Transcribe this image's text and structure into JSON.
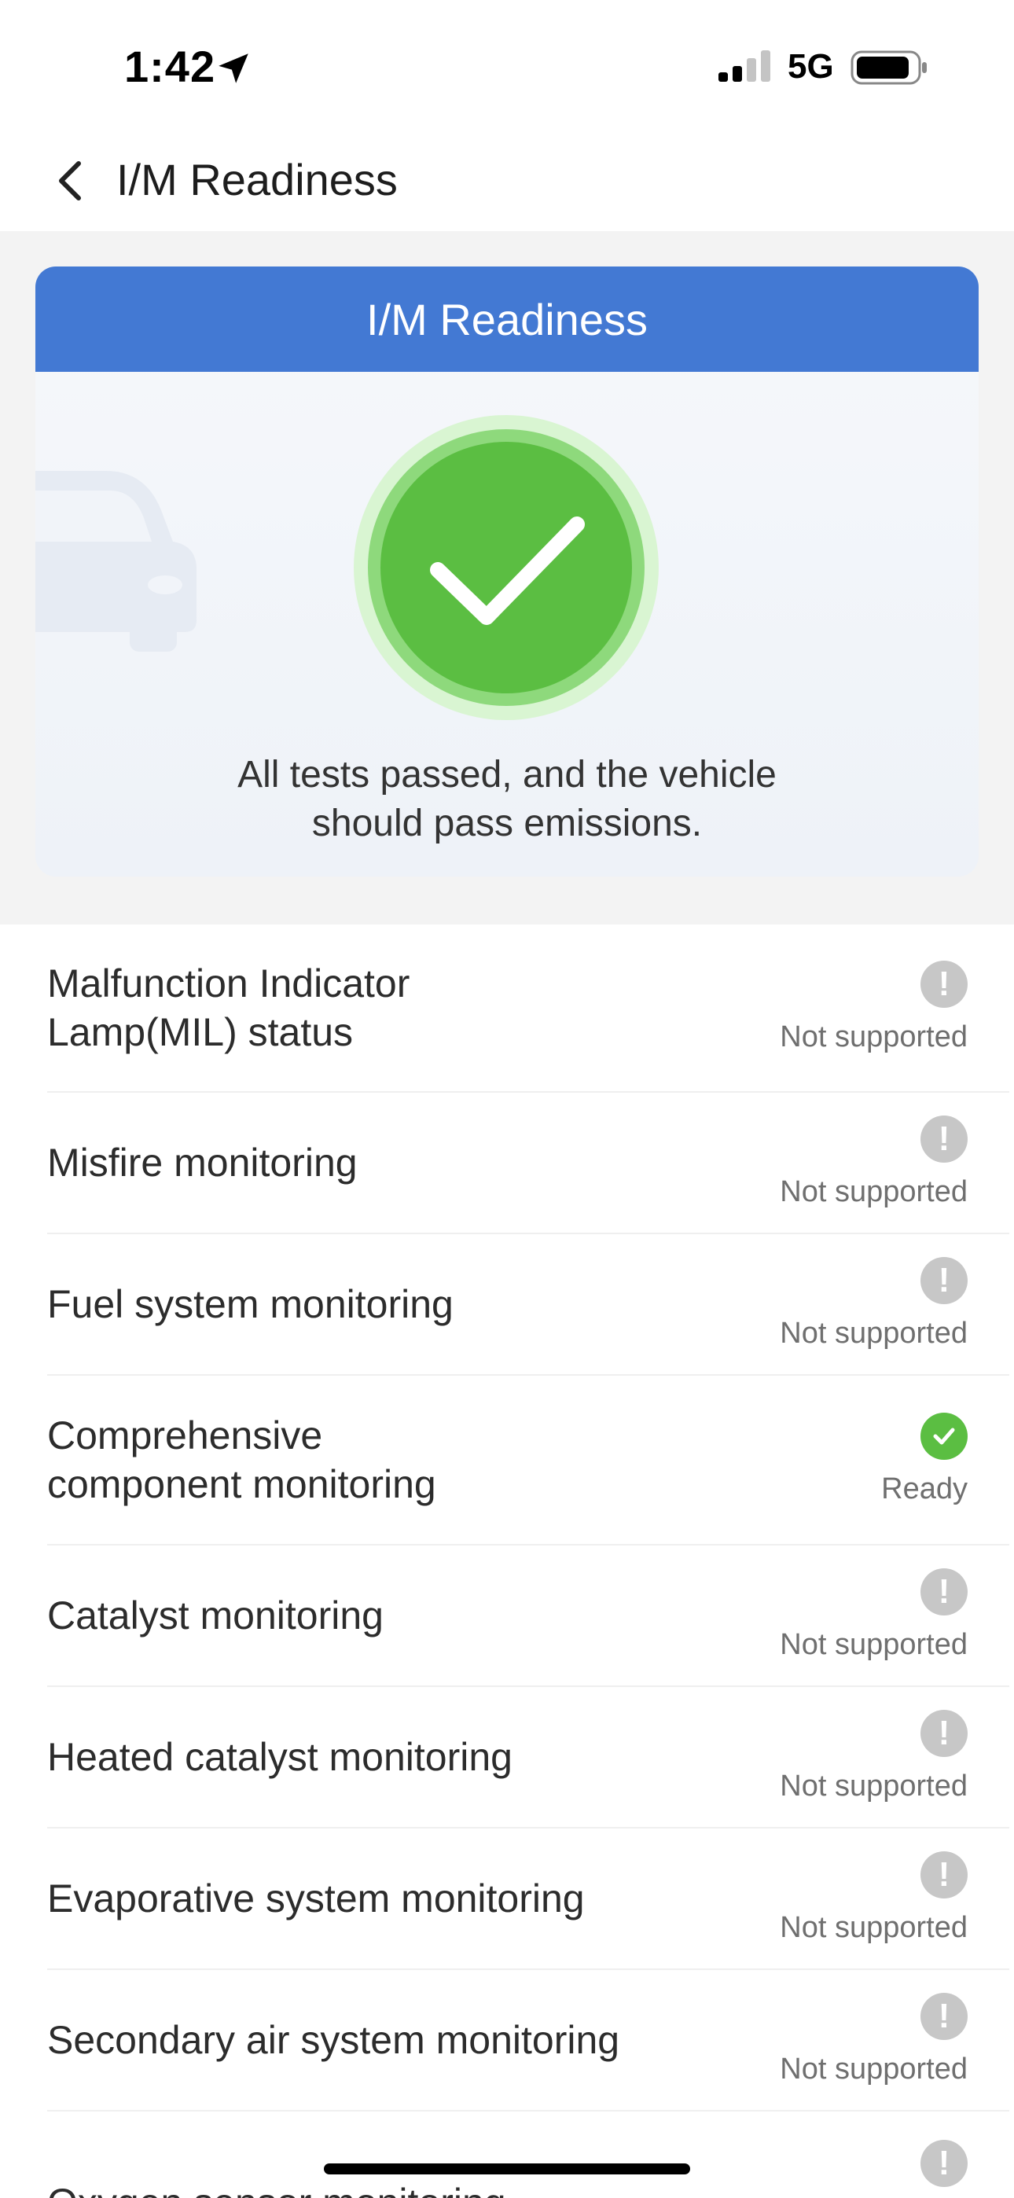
{
  "status_bar": {
    "time": "1:42",
    "network": "5G"
  },
  "nav": {
    "title": "I/M Readiness"
  },
  "summary": {
    "card_title": "I/M Readiness",
    "result_line1": "All tests passed, and the vehicle",
    "result_line2": "should pass emissions."
  },
  "colors": {
    "header_blue": "#4379d3",
    "pass_green": "#5bbe42",
    "not_supported_grey": "#c7c7c7"
  },
  "monitors": [
    {
      "label_line1": "Malfunction Indicator",
      "label_line2": "Lamp(MIL) status",
      "status": "Not supported",
      "icon": "exclamation-icon"
    },
    {
      "label_line1": "Misfire monitoring",
      "label_line2": "",
      "status": "Not supported",
      "icon": "exclamation-icon"
    },
    {
      "label_line1": "Fuel system monitoring",
      "label_line2": "",
      "status": "Not supported",
      "icon": "exclamation-icon"
    },
    {
      "label_line1": "Comprehensive",
      "label_line2": "component monitoring",
      "status": "Ready",
      "icon": "check-icon"
    },
    {
      "label_line1": "Catalyst monitoring",
      "label_line2": "",
      "status": "Not supported",
      "icon": "exclamation-icon"
    },
    {
      "label_line1": "Heated catalyst monitoring",
      "label_line2": "",
      "status": "Not supported",
      "icon": "exclamation-icon"
    },
    {
      "label_line1": "Evaporative system monitoring",
      "label_line2": "",
      "status": "Not supported",
      "icon": "exclamation-icon"
    },
    {
      "label_line1": "Secondary air system monitoring",
      "label_line2": "",
      "status": "Not supported",
      "icon": "exclamation-icon"
    },
    {
      "label_line1": "Oxygen sensor monitoring",
      "label_line2": "",
      "status": "",
      "icon": "exclamation-icon"
    }
  ]
}
